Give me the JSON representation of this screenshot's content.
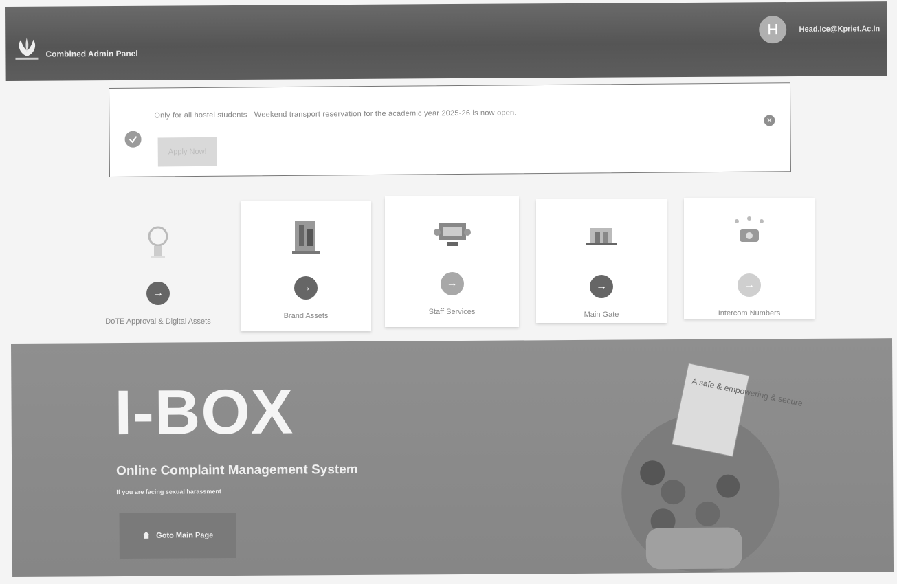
{
  "header": {
    "app_title": "Combined Admin Panel",
    "avatar_letter": "H",
    "user_email": "Head.Ice@Kpriet.Ac.In"
  },
  "notice": {
    "text": "Only for all hostel students - Weekend transport reservation for the academic year 2025-26 is now open.",
    "button_label": "Apply Now!",
    "close_icon": "close-circle-icon",
    "check_icon": "check-circle-icon"
  },
  "cards": [
    {
      "label": "DoTE Approval & Digital Assets",
      "icon": "arrow-right-icon"
    },
    {
      "label": "Brand Assets",
      "icon": "arrow-right-icon"
    },
    {
      "label": "Staff Services",
      "icon": "arrow-right-icon"
    },
    {
      "label": "Main Gate",
      "icon": "arrow-right-icon"
    },
    {
      "label": "Intercom Numbers",
      "icon": "arrow-right-icon"
    }
  ],
  "ibox": {
    "title": "I-BOX",
    "subtitle": "Online Complaint Management System",
    "note": "If you are facing sexual harassment",
    "button_label": "Goto Main Page",
    "sign_text": "A safe & empowering & secure environment FOR ALL"
  },
  "colors": {
    "topbar": "#5d5d5d",
    "banner": "#8a8a8a",
    "card_bg": "#ffffff"
  }
}
